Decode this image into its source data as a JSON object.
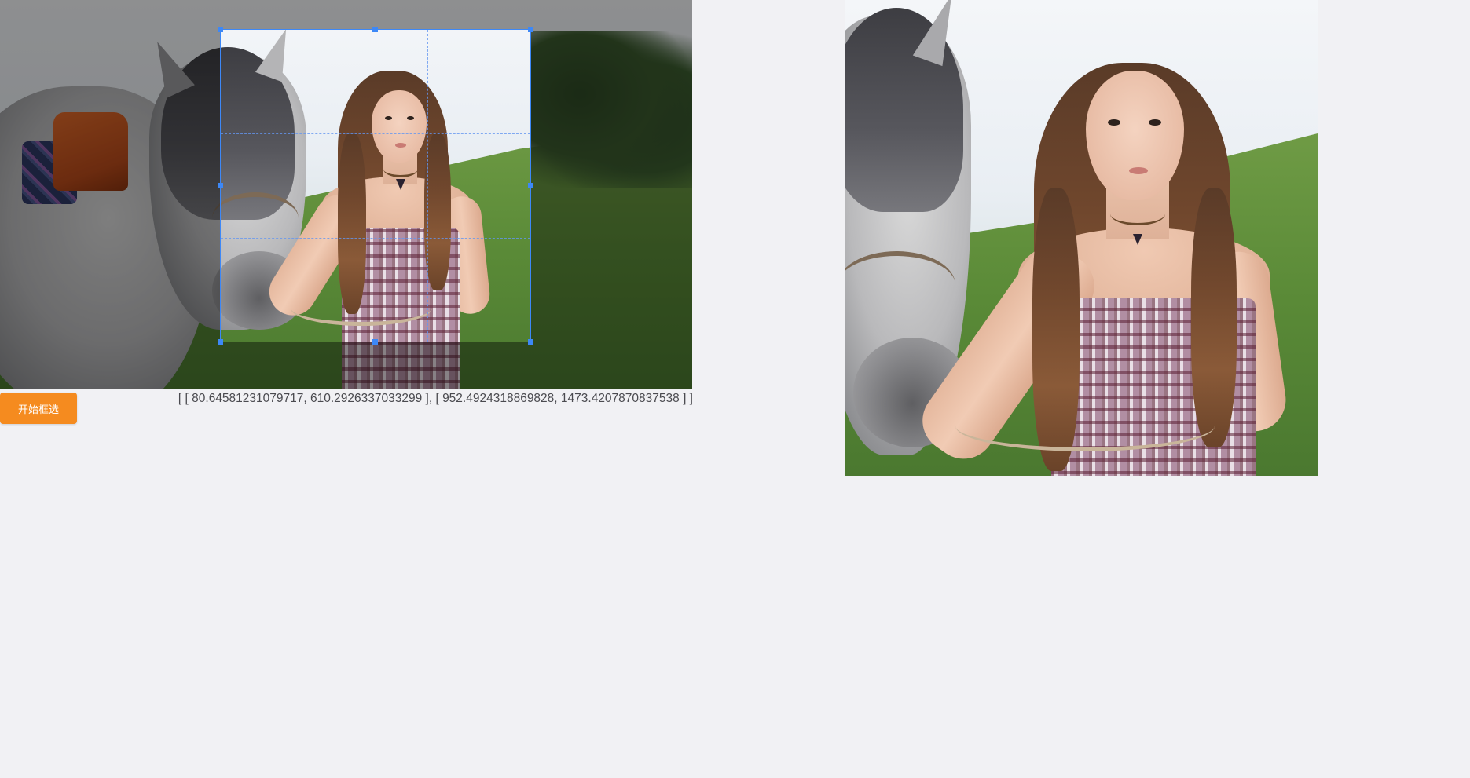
{
  "editor": {
    "start_button_label": "开始框选",
    "selection_readout": "[ [ 80.64581231079717, 610.2926337033299 ], [ 952.4924318869828, 1473.4207870837538 ] ]"
  },
  "colors": {
    "accent_button": "#f58b1f",
    "crop_border": "#3d88f7",
    "page_background": "#f1f1f4",
    "readout_text": "#4a4a4f"
  },
  "icons": {
    "crop_handle": "square-handle-icon"
  }
}
